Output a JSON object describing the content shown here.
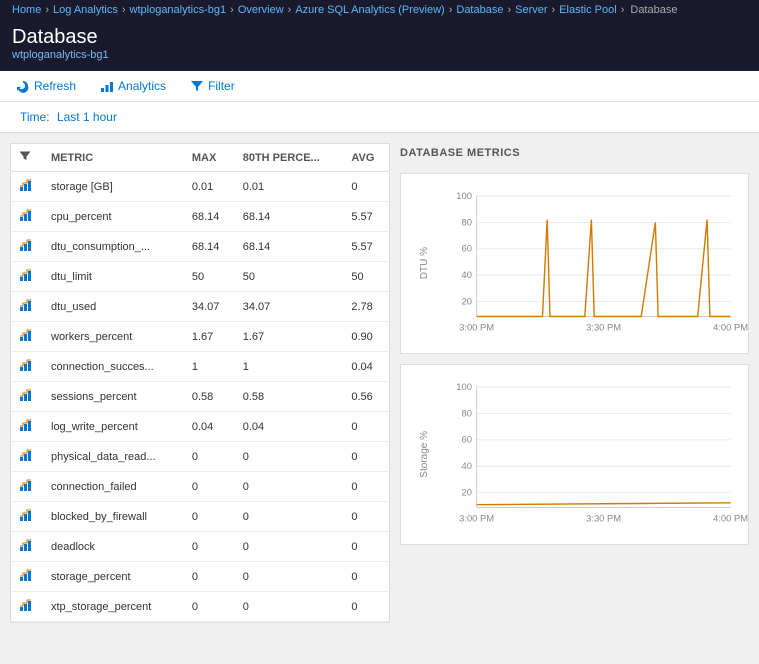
{
  "breadcrumb": {
    "items": [
      {
        "label": "Home",
        "link": true
      },
      {
        "label": "Log Analytics",
        "link": true
      },
      {
        "label": "wtploganalytics-bg1",
        "link": true
      },
      {
        "label": "Overview",
        "link": true
      },
      {
        "label": "Azure SQL Analytics (Preview)",
        "link": true
      },
      {
        "label": "Database",
        "link": true
      },
      {
        "label": "Server",
        "link": true
      },
      {
        "label": "Elastic Pool",
        "link": true
      },
      {
        "label": "Database",
        "link": false
      }
    ]
  },
  "page": {
    "title": "Database",
    "subtitle": "wtploganalytics-bg1"
  },
  "toolbar": {
    "refresh_label": "Refresh",
    "analytics_label": "Analytics",
    "filter_label": "Filter"
  },
  "time_filter": {
    "label": "Time:",
    "value": "Last 1 hour"
  },
  "metrics_table": {
    "columns": [
      {
        "key": "metric",
        "label": "METRIC"
      },
      {
        "key": "max",
        "label": "MAX"
      },
      {
        "key": "pct80",
        "label": "80TH PERCE..."
      },
      {
        "key": "avg",
        "label": "AVG"
      }
    ],
    "rows": [
      {
        "metric": "storage [GB]",
        "max": "0.01",
        "pct80": "0.01",
        "avg": "0"
      },
      {
        "metric": "cpu_percent",
        "max": "68.14",
        "pct80": "68.14",
        "avg": "5.57"
      },
      {
        "metric": "dtu_consumption_...",
        "max": "68.14",
        "pct80": "68.14",
        "avg": "5.57"
      },
      {
        "metric": "dtu_limit",
        "max": "50",
        "pct80": "50",
        "avg": "50"
      },
      {
        "metric": "dtu_used",
        "max": "34.07",
        "pct80": "34.07",
        "avg": "2.78"
      },
      {
        "metric": "workers_percent",
        "max": "1.67",
        "pct80": "1.67",
        "avg": "0.90"
      },
      {
        "metric": "connection_succes...",
        "max": "1",
        "pct80": "1",
        "avg": "0.04"
      },
      {
        "metric": "sessions_percent",
        "max": "0.58",
        "pct80": "0.58",
        "avg": "0.56"
      },
      {
        "metric": "log_write_percent",
        "max": "0.04",
        "pct80": "0.04",
        "avg": "0"
      },
      {
        "metric": "physical_data_read...",
        "max": "0",
        "pct80": "0",
        "avg": "0"
      },
      {
        "metric": "connection_failed",
        "max": "0",
        "pct80": "0",
        "avg": "0"
      },
      {
        "metric": "blocked_by_firewall",
        "max": "0",
        "pct80": "0",
        "avg": "0"
      },
      {
        "metric": "deadlock",
        "max": "0",
        "pct80": "0",
        "avg": "0"
      },
      {
        "metric": "storage_percent",
        "max": "0",
        "pct80": "0",
        "avg": "0"
      },
      {
        "metric": "xtp_storage_percent",
        "max": "0",
        "pct80": "0",
        "avg": "0"
      }
    ]
  },
  "charts": {
    "title": "DATABASE METRICS",
    "dtu_chart": {
      "y_label": "DTU %",
      "y_ticks": [
        "100",
        "80",
        "60",
        "40",
        "20"
      ],
      "x_ticks": [
        "3:00 PM",
        "3:30 PM",
        "4:00 PM"
      ]
    },
    "storage_chart": {
      "y_label": "Storage %",
      "y_ticks": [
        "100",
        "80",
        "60",
        "40",
        "20"
      ],
      "x_ticks": [
        "3:00 PM",
        "3:30 PM",
        "4:00 PM"
      ]
    }
  },
  "colors": {
    "accent_blue": "#0078d4",
    "topbar_bg": "#1a1a2e",
    "chart_line": "#d47a00"
  }
}
